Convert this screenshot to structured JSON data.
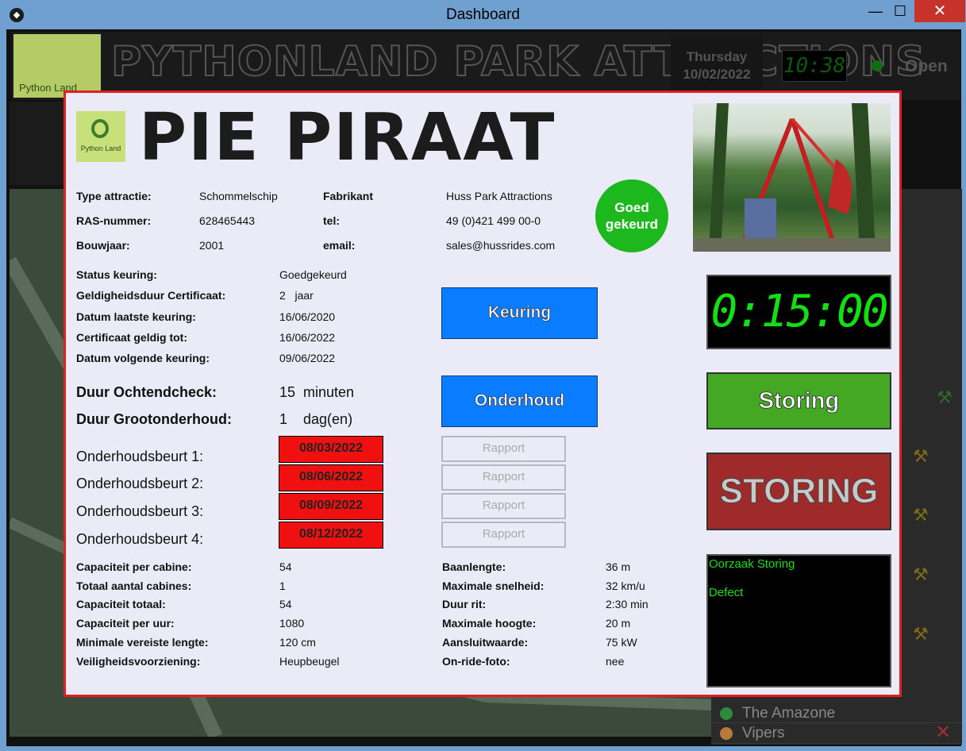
{
  "window": {
    "title": "Dashboard",
    "app_icon": "kivy-icon"
  },
  "header": {
    "park_title": "PYTHONLAND PARK ATTRACTIONS",
    "logo_text": "Python Land",
    "day": "Thursday",
    "date": "10/02/2022",
    "clock": "10:38",
    "status": "Open"
  },
  "background_list": [
    {
      "name": "The Amazone",
      "dot_color": "#2e8b3a"
    },
    {
      "name": "Vipers",
      "dot_color": "#b87a3a"
    }
  ],
  "modal": {
    "logo_text": "Python Land",
    "title": "PIE PIRAAT",
    "badge": [
      "Goed",
      "gekeurd"
    ],
    "info": [
      {
        "label": "Type attractie:",
        "value": "Schommelschip"
      },
      {
        "label": "RAS-nummer:",
        "value": "628465443"
      },
      {
        "label": "Bouwjaar:",
        "value": "2001"
      }
    ],
    "manufacturer": [
      {
        "label": "Fabrikant",
        "value": "Huss Park Attractions"
      },
      {
        "label": "tel:",
        "value": "49 (0)421 499 00-0"
      },
      {
        "label": "email:",
        "value": "sales@hussrides.com"
      }
    ],
    "keuring": [
      {
        "label": "Status keuring:",
        "value": "Goedgekeurd"
      },
      {
        "label": "Geldigheidsduur Certificaat:",
        "value": "2   jaar"
      },
      {
        "label": "Datum laatste keuring:",
        "value": "16/06/2020"
      },
      {
        "label": "Certificaat geldig tot:",
        "value": "16/06/2022"
      },
      {
        "label": "Datum volgende keuring:",
        "value": "09/06/2022"
      }
    ],
    "durations": [
      {
        "label": "Duur Ochtendcheck:",
        "value": "15  minuten"
      },
      {
        "label": "Duur Grootonderhoud:",
        "value": "1    dag(en)"
      }
    ],
    "maintenance": [
      {
        "label": "Onderhoudsbeurt 1:",
        "date": "08/03/2022",
        "rapport": "Rapport"
      },
      {
        "label": "Onderhoudsbeurt 2:",
        "date": "08/06/2022",
        "rapport": "Rapport"
      },
      {
        "label": "Onderhoudsbeurt 3:",
        "date": "08/09/2022",
        "rapport": "Rapport"
      },
      {
        "label": "Onderhoudsbeurt 4:",
        "date": "08/12/2022",
        "rapport": "Rapport"
      }
    ],
    "specs_left": [
      {
        "label": "Capaciteit per cabine:",
        "value": "54"
      },
      {
        "label": "Totaal aantal cabines:",
        "value": "1"
      },
      {
        "label": "Capaciteit totaal:",
        "value": "54"
      },
      {
        "label": "Capaciteit per uur:",
        "value": "1080"
      },
      {
        "label": "Minimale vereiste lengte:",
        "value": "120 cm"
      },
      {
        "label": "Veiligheidsvoorziening:",
        "value": "Heupbeugel"
      }
    ],
    "specs_right": [
      {
        "label": "Baanlengte:",
        "value": "36 m"
      },
      {
        "label": "Maximale snelheid:",
        "value": "32 km/u"
      },
      {
        "label": "Duur rit:",
        "value": "2:30 min"
      },
      {
        "label": "Maximale hoogte:",
        "value": "20 m"
      },
      {
        "label": "Aansluitwaarde:",
        "value": "75 kW"
      },
      {
        "label": "On-ride-foto:",
        "value": "nee"
      }
    ],
    "buttons": {
      "keuring": "Keuring",
      "onderhoud": "Onderhoud",
      "storing": "Storing",
      "storing_status": "STORING"
    },
    "timer": "0:15:00",
    "oorzaak": {
      "title": "Oorzaak Storing",
      "cause": "Defect"
    }
  },
  "colors": {
    "modal_border": "#e02020",
    "ok_green": "#1db81d",
    "blue_button": "#0a7cff",
    "date_red": "#f01010",
    "storing_green": "#45a825",
    "storing_red": "#9e2a2a",
    "lcd_green": "#12e012"
  }
}
